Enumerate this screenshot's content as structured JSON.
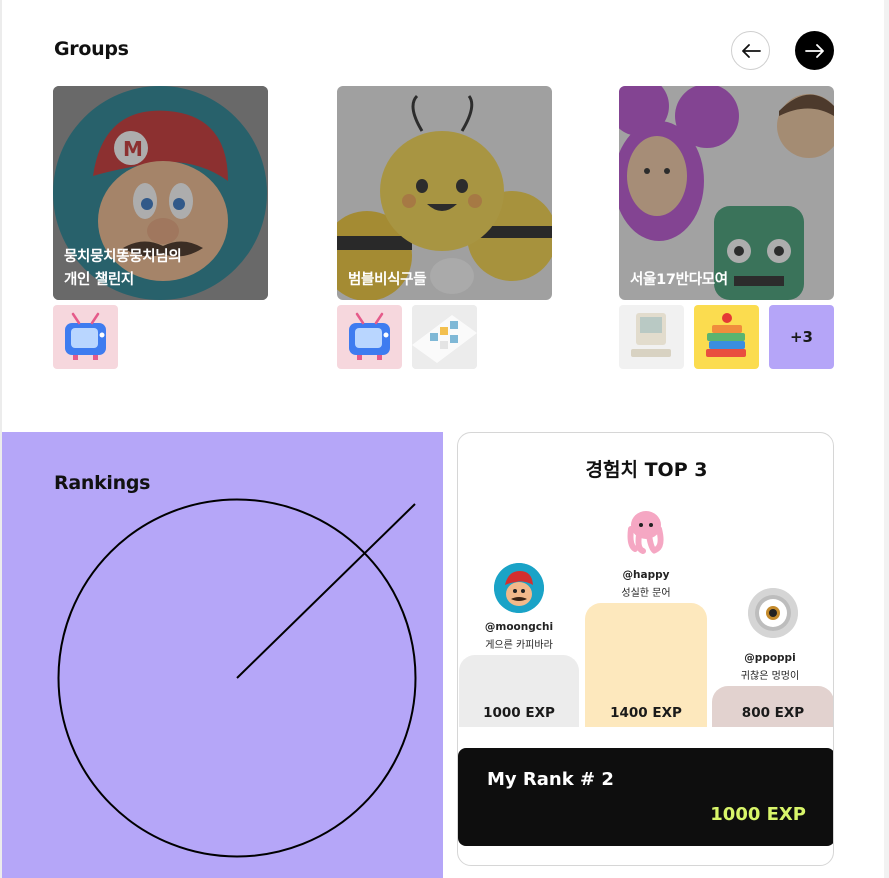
{
  "groups": {
    "title": "Groups",
    "prev_icon": "arrow-left-icon",
    "next_icon": "arrow-right-icon",
    "cards": [
      {
        "label": "뭉치뭉치똥뭉치님의\n개인 챌린지",
        "image": "mario-avatar",
        "more_count": ""
      },
      {
        "label": "범블비식구들",
        "image": "bumblebee-toys",
        "more_count": ""
      },
      {
        "label": "서울17반다모여",
        "image": "cartoon-faces-robot",
        "more_count": "+3"
      }
    ]
  },
  "rankings": {
    "title": "Rankings"
  },
  "top3": {
    "title": "경험치 TOP 3",
    "entries": [
      {
        "rank": 2,
        "handle": "@moongchi",
        "nickname": "게으른 카피바라",
        "exp": "1000 EXP",
        "avatar": "mario-avatar"
      },
      {
        "rank": 1,
        "handle": "@happy",
        "nickname": "성실한 문어",
        "exp": "1400 EXP",
        "avatar": "pink-octopus-avatar"
      },
      {
        "rank": 3,
        "handle": "@ppoppi",
        "nickname": "귀찮은 멍멍이",
        "exp": "800 EXP",
        "avatar": "minion-eye-avatar"
      }
    ],
    "my_rank_label": "My Rank # 2",
    "my_rank_exp": "1000 EXP"
  },
  "colors": {
    "accent_purple": "#b5a6f8",
    "podium_gray": "#ececec",
    "podium_yellow": "#fde8bd",
    "podium_rose": "#e2d2cf",
    "exp_green": "#d8f56a"
  }
}
